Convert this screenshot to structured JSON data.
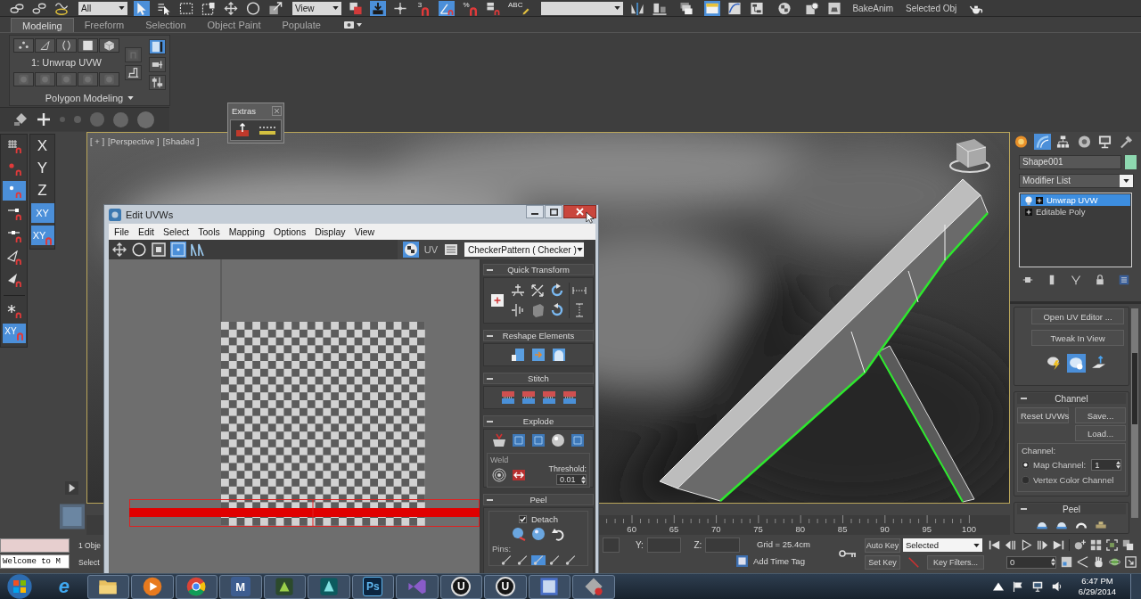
{
  "top_toolbar": {
    "tools": [
      {
        "kind": "link",
        "selected": false
      },
      {
        "kind": "unlink",
        "selected": false
      },
      {
        "kind": "bind",
        "selected": false
      },
      {
        "kind": "dropdown",
        "label": "All"
      },
      {
        "kind": "select",
        "selected": true
      },
      {
        "kind": "select-name",
        "selected": false
      },
      {
        "kind": "rect-region",
        "selected": false
      },
      {
        "kind": "window",
        "selected": false
      },
      {
        "kind": "move",
        "selected": false
      },
      {
        "kind": "rotate",
        "selected": false
      },
      {
        "kind": "scale",
        "selected": false
      },
      {
        "kind": "dropdown",
        "label": "View"
      },
      {
        "kind": "pivot",
        "selected": false
      },
      {
        "kind": "manipulate",
        "selected": true
      },
      {
        "kind": "crosshair",
        "selected": false
      },
      {
        "kind": "snap",
        "label": "3",
        "selected": false
      },
      {
        "kind": "angle-snap",
        "selected": true
      },
      {
        "kind": "snap",
        "label": "%",
        "selected": false
      },
      {
        "kind": "spinner-snap",
        "selected": false
      },
      {
        "kind": "edit-named",
        "label": "ABC",
        "selected": false
      },
      {
        "kind": "dropdown"
      },
      {
        "kind": "mirror",
        "selected": false
      },
      {
        "kind": "align",
        "selected": false
      },
      {
        "kind": "layers",
        "selected": false
      },
      {
        "kind": "ribbon",
        "selected": true
      },
      {
        "kind": "curve",
        "selected": false
      },
      {
        "kind": "schematic",
        "selected": false
      },
      {
        "kind": "material",
        "selected": false
      },
      {
        "kind": "render-setup",
        "selected": false
      },
      {
        "kind": "render-frame",
        "selected": false
      },
      {
        "kind": "text",
        "label": "BakeAnim"
      },
      {
        "kind": "text",
        "label": "Selected Obj"
      },
      {
        "kind": "teapot",
        "selected": false
      }
    ]
  },
  "ribbon": {
    "tabs": [
      {
        "label": "Modeling",
        "selected": true
      },
      {
        "label": "Freeform",
        "selected": false
      },
      {
        "label": "Selection",
        "selected": false
      },
      {
        "label": "Object Paint",
        "selected": false
      },
      {
        "label": "Populate",
        "selected": false
      }
    ],
    "modifier": "1: Unwrap UVW",
    "panel_title": "Polygon Modeling",
    "tools_left": [
      {
        "kind": "faded-stand",
        "selected": false
      },
      {
        "kind": "stand",
        "selected": false
      }
    ],
    "tools_right": [
      {
        "kind": "panel",
        "selected": true
      },
      {
        "kind": "pin",
        "selected": false
      },
      {
        "kind": "sliders",
        "selected": false
      }
    ]
  },
  "extras": {
    "title": "Extras"
  },
  "snap_toolbar": {
    "groups": [
      [
        {
          "kind": "grid",
          "selected": false
        },
        {
          "kind": "point",
          "selected": false
        },
        {
          "kind": "vertex",
          "selected": true
        },
        {
          "kind": "endpoint",
          "selected": false
        },
        {
          "kind": "midpoint",
          "selected": false
        },
        {
          "kind": "edge",
          "selected": false
        },
        {
          "kind": "face",
          "selected": false
        }
      ],
      [
        {
          "kind": "pivot-snap",
          "selected": false
        },
        {
          "kind": "axis",
          "label": "XY",
          "selected": true
        }
      ]
    ]
  },
  "axis_toolbar": [
    {
      "kind": "axis",
      "label": "X",
      "selected": false,
      "snap": false
    },
    {
      "kind": "axis",
      "label": "Y",
      "selected": false,
      "snap": false
    },
    {
      "kind": "axis",
      "label": "Z",
      "selected": false,
      "snap": false
    },
    {
      "kind": "plane",
      "label": "XY",
      "selected": true,
      "snap": false
    },
    {
      "kind": "plane",
      "label": "XY",
      "selected": true,
      "snap": true
    }
  ],
  "viewport": {
    "labels": [
      "[ + ]",
      "[Perspective ]",
      "[Shaded ]"
    ]
  },
  "uv_editor": {
    "title": "Edit UVWs",
    "menu": [
      "File",
      "Edit",
      "Select",
      "Tools",
      "Mapping",
      "Options",
      "Display",
      "View"
    ],
    "tools": [
      {
        "kind": "move",
        "selected": false
      },
      {
        "kind": "rotate",
        "selected": false
      },
      {
        "kind": "uv-scale",
        "selected": false
      },
      {
        "kind": "freeform",
        "selected": true
      },
      {
        "kind": "mirror-pair",
        "selected": false
      }
    ],
    "show_map": {
      "selected": true
    },
    "uv_label": "UV",
    "texture": "CheckerPattern ( Checker )",
    "rollouts": [
      {
        "kind": "quick-transform",
        "title": "Quick Transform",
        "expanded": true
      },
      {
        "kind": "reshape",
        "title": "Reshape Elements",
        "expanded": true
      },
      {
        "kind": "stitch",
        "title": "Stitch",
        "expanded": true
      },
      {
        "kind": "explode",
        "title": "Explode",
        "expanded": true,
        "weld": "Weld",
        "threshold_label": "Threshold:",
        "threshold": "0.01"
      },
      {
        "kind": "peel",
        "title": "Peel",
        "expanded": true,
        "detach": {
          "label": "Detach",
          "checked": true
        },
        "pins_label": "Pins:",
        "pins": [
          {
            "selected": false
          },
          {
            "selected": false
          },
          {
            "selected": true
          },
          {
            "selected": false
          },
          {
            "selected": false
          }
        ]
      }
    ]
  },
  "command_panel": {
    "tabs": [
      {
        "kind": "create",
        "selected": false
      },
      {
        "kind": "modify",
        "selected": true
      },
      {
        "kind": "hierarchy",
        "selected": false
      },
      {
        "kind": "motion",
        "selected": false
      },
      {
        "kind": "display",
        "selected": false
      },
      {
        "kind": "utilities",
        "selected": false
      }
    ],
    "object": {
      "name": "Shape001",
      "color": "#8ed8b0"
    },
    "modifier_list": "Modifier List",
    "stack": [
      {
        "kind": "modifier",
        "label": "Unwrap UVW",
        "selected": true
      },
      {
        "kind": "object",
        "label": "Editable Poly",
        "selected": false
      }
    ],
    "editor_buttons": [
      "Open UV Editor ...",
      "Tweak In View"
    ],
    "tweak_tools": [
      {
        "kind": "lightning",
        "selected": false
      },
      {
        "kind": "tweak",
        "selected": true
      },
      {
        "kind": "plane",
        "selected": false
      }
    ],
    "channel": {
      "title": "Channel",
      "expanded": true,
      "reset": "Reset UVWs",
      "save": "Save...",
      "load": "Load...",
      "group": "Channel:",
      "options": [
        {
          "label": "Map Channel:",
          "selected": true,
          "value": "1"
        },
        {
          "label": "Vertex Color Channel",
          "selected": false
        }
      ]
    },
    "peel": {
      "title": "Peel",
      "expanded": true
    }
  },
  "timeline": {
    "ticks": [
      "60",
      "65",
      "70",
      "75",
      "80",
      "85",
      "90",
      "95",
      "100"
    ]
  },
  "status": {
    "listener_output": "Welcome to M",
    "selection": "1 Obje",
    "prompt": "Select",
    "coords": [
      "Y:",
      "Z:"
    ],
    "grid": "Grid = 25.4cm",
    "time_tag": "Add Time Tag"
  },
  "animation": {
    "auto_key": "Auto Key",
    "key_mode": "Selected",
    "set_key": "Set Key",
    "key_filters": "Key Filters...",
    "frame": "0"
  },
  "taskbar": {
    "apps": [
      {
        "kind": "ie",
        "glyph": "e",
        "running": false
      },
      {
        "kind": "folder",
        "running": true
      },
      {
        "kind": "media",
        "running": true
      },
      {
        "kind": "chrome",
        "running": true
      },
      {
        "kind": "letter",
        "glyph": "M",
        "running": true
      },
      {
        "kind": "green",
        "running": true
      },
      {
        "kind": "max",
        "running": true
      },
      {
        "kind": "ps",
        "glyph": "Ps",
        "running": true
      },
      {
        "kind": "vs",
        "running": true
      },
      {
        "kind": "unreal",
        "glyph": "U",
        "running": true
      },
      {
        "kind": "unreal",
        "glyph": "U",
        "running": true
      },
      {
        "kind": "max-blue",
        "running": true
      },
      {
        "kind": "game",
        "running": true
      }
    ],
    "time": "6:47 PM",
    "date": "6/29/2014"
  }
}
